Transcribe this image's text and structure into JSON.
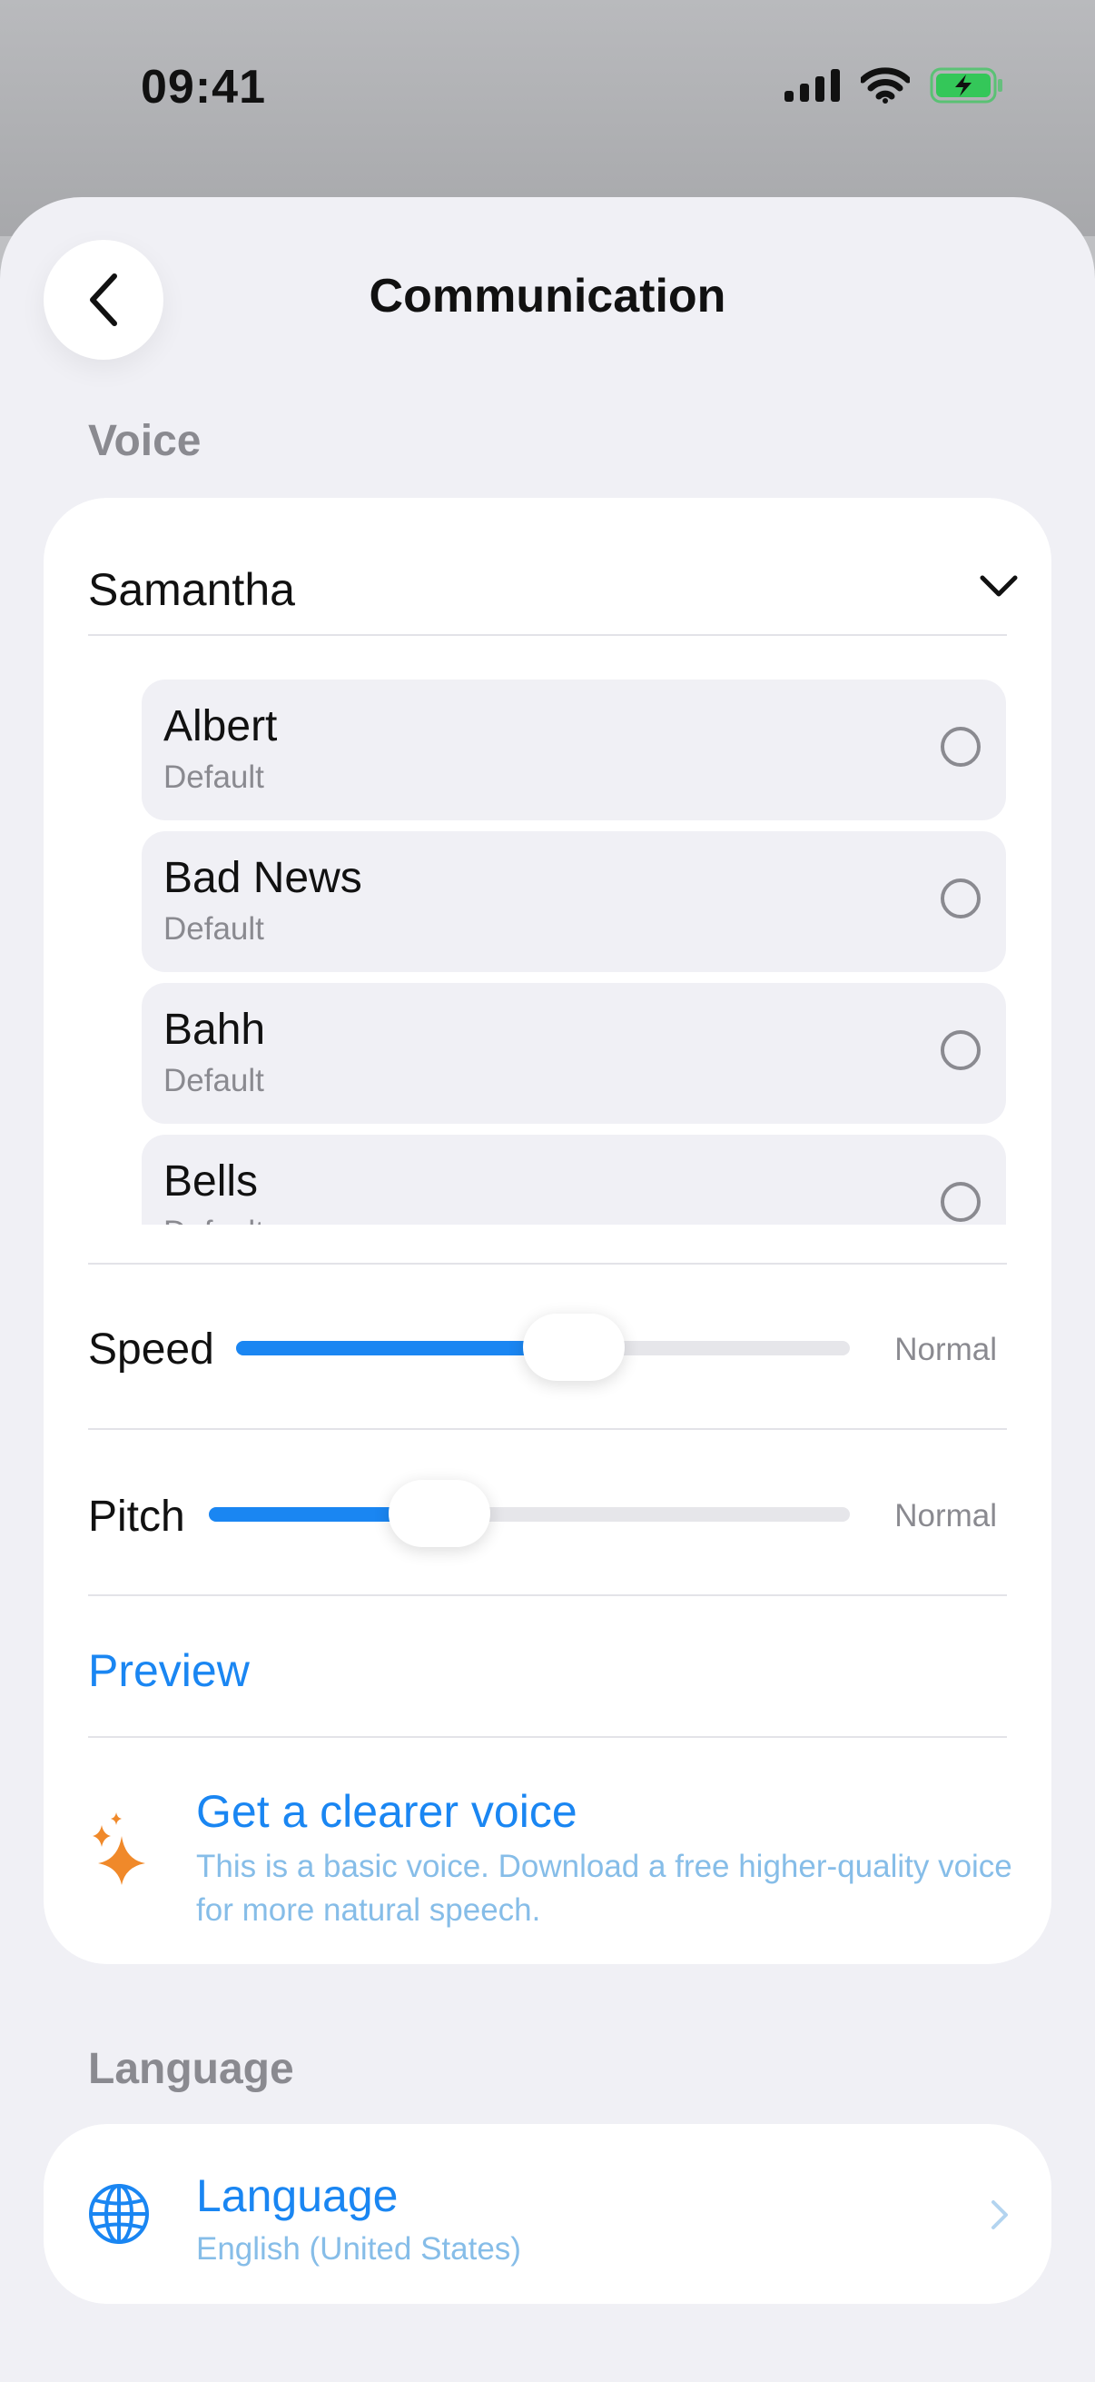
{
  "status_bar": {
    "time": "09:41",
    "icons": [
      "cellular-signal-icon",
      "wifi-icon",
      "battery-charging-icon"
    ],
    "battery_color": "#34c759"
  },
  "header": {
    "title": "Communication",
    "back_icon": "chevron-left-icon"
  },
  "voice_section": {
    "label": "Voice",
    "selected_voice": "Samantha",
    "voices": [
      {
        "name": "Albert",
        "subtitle": "Default",
        "selected": false
      },
      {
        "name": "Bad News",
        "subtitle": "Default",
        "selected": false
      },
      {
        "name": "Bahh",
        "subtitle": "Default",
        "selected": false
      },
      {
        "name": "Bells",
        "subtitle": "Default",
        "selected": false
      }
    ],
    "speed": {
      "label": "Speed",
      "value": "Normal",
      "level": 0.55
    },
    "pitch": {
      "label": "Pitch",
      "value": "Normal",
      "level": 0.36
    },
    "preview_label": "Preview",
    "clearer": {
      "title": "Get a clearer voice",
      "description": "This is a basic voice. Download a free higher-quality voice for more natural speech."
    }
  },
  "language_section": {
    "label": "Language",
    "item_title": "Language",
    "item_value": "English (United States)"
  },
  "colors": {
    "accent": "#1a86f2",
    "sparkle": "#f0892a",
    "background": "#f0f0f5"
  }
}
